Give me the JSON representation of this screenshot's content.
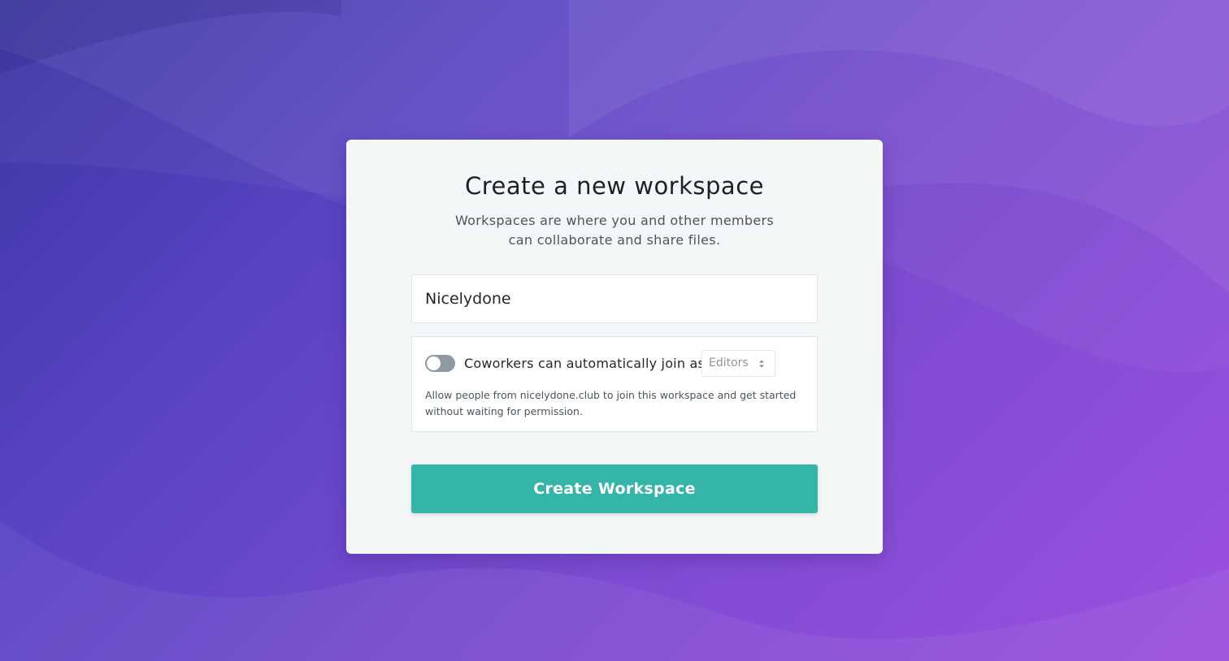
{
  "dialog": {
    "title": "Create a new workspace",
    "subtitle_line1": "Workspaces are where you and other members",
    "subtitle_line2": "can collaborate and share files."
  },
  "workspace_name": {
    "value": "Nicelydone"
  },
  "auto_join": {
    "enabled": false,
    "label": "Coworkers can automatically join as",
    "role_selected": "Editors",
    "hint_line1": "Allow people from nicelydone.club to join this workspace and get started",
    "hint_line2": "without waiting for permission."
  },
  "actions": {
    "create_label": "Create Workspace"
  },
  "icons": {
    "role_select": "updown-chevron-icon",
    "toggle": "toggle-switch"
  },
  "colors": {
    "primary_button": "#35b5a7",
    "toggle_off": "#8d99a3",
    "background_start": "#3b36a3",
    "background_end": "#9d4fe0",
    "card": "#f4f7f7"
  }
}
